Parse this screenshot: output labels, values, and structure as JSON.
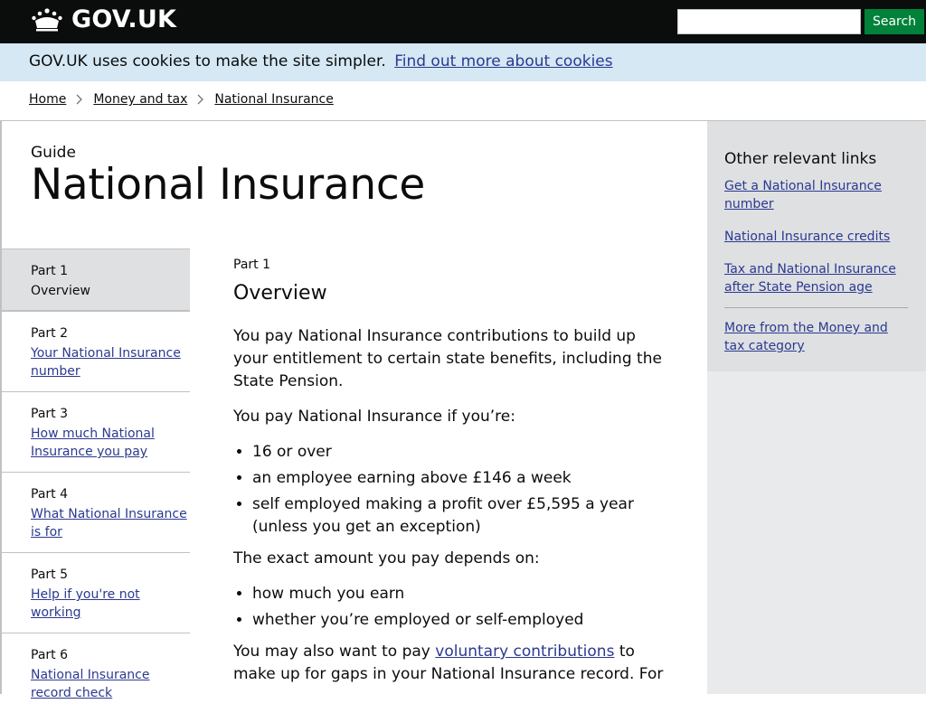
{
  "header": {
    "logo_text": "GOV.UK",
    "search_placeholder": "",
    "search_button": "Search"
  },
  "cookie_banner": {
    "text": "GOV.UK uses cookies to make the site simpler.",
    "link": "Find out more about cookies"
  },
  "breadcrumb": [
    "Home",
    "Money and tax",
    "National Insurance"
  ],
  "page": {
    "guide_label": "Guide",
    "title": "National Insurance"
  },
  "parts": [
    {
      "number": "Part 1",
      "title": "Overview"
    },
    {
      "number": "Part 2",
      "title": "Your National Insurance number"
    },
    {
      "number": "Part 3",
      "title": "How much National Insurance you pay"
    },
    {
      "number": "Part 4",
      "title": "What National Insurance is for"
    },
    {
      "number": "Part 5",
      "title": "Help if you're not working"
    },
    {
      "number": "Part 6",
      "title": "National Insurance record check"
    }
  ],
  "content": {
    "part_label": "Part 1",
    "heading": "Overview",
    "p1": "You pay National Insurance contributions to build up your entitlement to certain state benefits, including the State Pension.",
    "p2": "You pay National Insurance if you’re:",
    "list1": [
      "16 or over",
      "an employee earning above £146 a week",
      "self employed making a profit over £5,595 a year (unless you get an exception)"
    ],
    "p3": "The exact amount you pay depends on:",
    "list2": [
      "how much you earn",
      "whether you’re employed or self-employed"
    ],
    "p4_start": "You may also want to pay",
    "p4_link": "voluntary contributions",
    "p4_end": "to make up for gaps in your National Insurance record. For"
  },
  "sidebar": {
    "heading": "Other relevant links",
    "links": [
      "Get a National Insurance number",
      "National Insurance credits",
      "Tax and National Insurance after State Pension age"
    ],
    "more": "More from the Money and tax category"
  },
  "colors": {
    "header_bg": "#0b0c0c",
    "search_button_bg": "#00823b",
    "cookie_bg": "#d5e8f3",
    "link": "#2b3990",
    "sidebar_bg": "#dee0e2"
  }
}
